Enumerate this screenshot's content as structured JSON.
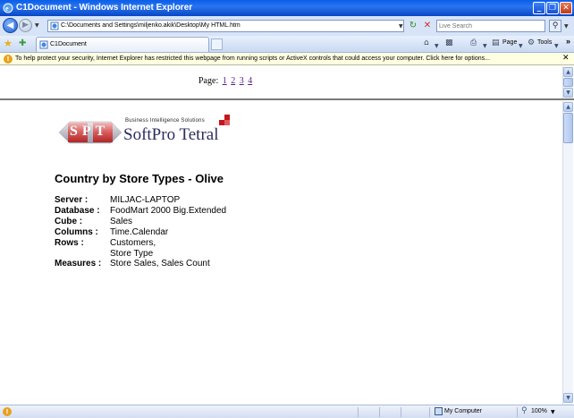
{
  "window": {
    "title": "C1Document - Windows Internet Explorer",
    "minimize": "_",
    "maximize": "❐",
    "close": "✕"
  },
  "address": {
    "url": "C:\\Documents and Settings\\miljenko.akik\\Desktop\\My HTML.htm",
    "search_placeholder": "Live Search"
  },
  "toolbar": {
    "tab_label": "C1Document",
    "page_label": "Page",
    "tools_label": "Tools",
    "overflow": "»"
  },
  "infobar": {
    "message": "To help protect your security, Internet Explorer has restricted this webpage from running scripts or ActiveX controls that could access your computer. Click here for options..."
  },
  "pager": {
    "label": "Page:",
    "pages": [
      "1",
      "2",
      "3",
      "4"
    ]
  },
  "logo": {
    "letters": "SPT",
    "tagline": "Business   Intelligence   Solutions",
    "brand": "SoftPro Tetral"
  },
  "report": {
    "title": "Country by Store Types - Olive",
    "fields": [
      {
        "key": "Server :",
        "value": "MILJAC-LAPTOP"
      },
      {
        "key": "Database :",
        "value": "FoodMart 2000 Big.Extended"
      },
      {
        "key": "Cube :",
        "value": "Sales"
      },
      {
        "key": "Columns :",
        "value": "Time.Calendar"
      },
      {
        "key": "Rows :",
        "value": "Customers,"
      },
      {
        "key": "",
        "value": "Store Type"
      },
      {
        "key": "Measures :",
        "value": "Store Sales, Sales Count"
      }
    ]
  },
  "status": {
    "zone": "My Computer",
    "zoom": "100%"
  },
  "colors": {
    "titlebar": "#0a5ee8",
    "infobar": "#ffffe1",
    "brand": "#2c2c5e",
    "brand_accent": "#c4161c",
    "link_visited": "#551a8b"
  }
}
